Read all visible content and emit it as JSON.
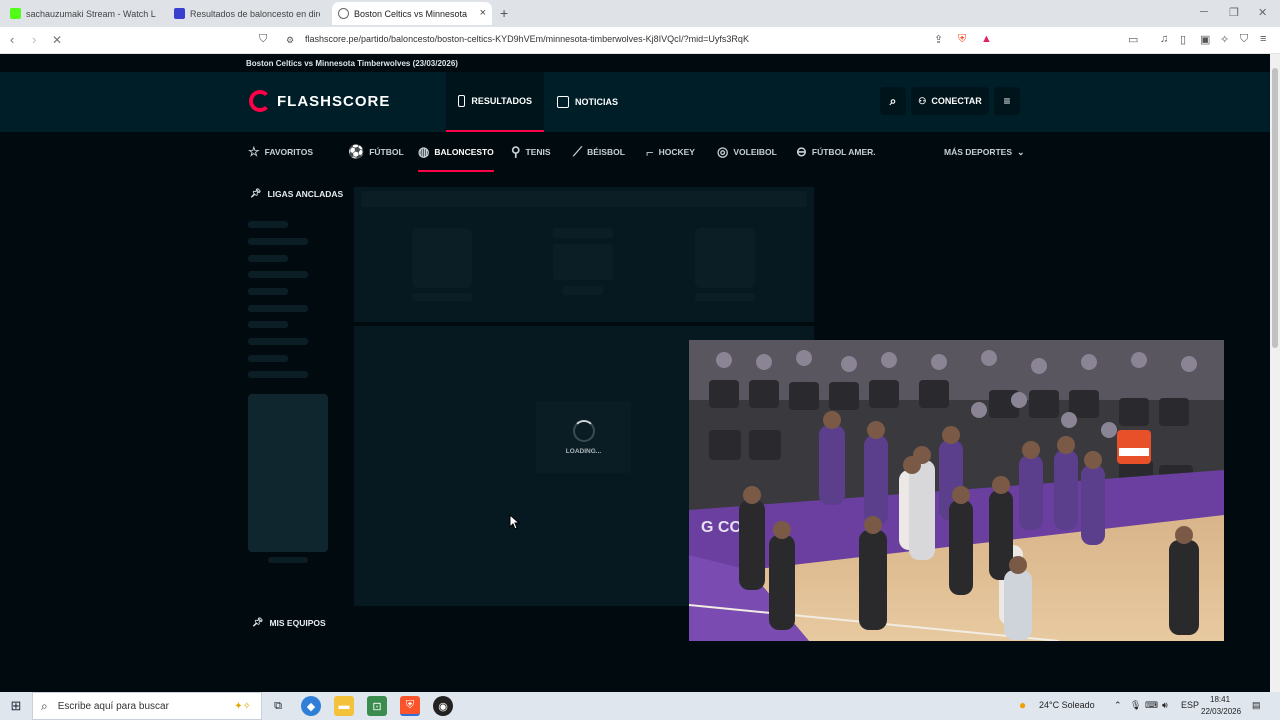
{
  "browser": {
    "tabs": [
      {
        "title": "sachauzumaki Stream - Watch Live o",
        "favicon_color": "#53fc18"
      },
      {
        "title": "Resultados de baloncesto en directo",
        "favicon_color": "#3b3fd0"
      },
      {
        "title": "Boston Celtics vs Minnesota Timb",
        "favicon_color": "#666666"
      }
    ],
    "new_tab_icon": "+",
    "close_icon": "×",
    "url": "flashscore.pe/partido/baloncesto/boston-celtics-KYD9hVEm/minnesota-timberwolves-Kj8IVQcI/?mid=Uyfs3RqK"
  },
  "page": {
    "match_title": "Boston Celtics vs Minnesota Timberwolves (23/03/2026)",
    "logo_text": "FLASHSCORE",
    "header_nav": [
      {
        "label": "RESULTADOS",
        "icon": "scoreboard-icon"
      },
      {
        "label": "NOTICIAS",
        "icon": "news-icon"
      }
    ],
    "login_label": "CONECTAR",
    "sports": [
      {
        "label": "FAVORITOS",
        "icon": "☆"
      },
      {
        "label": "FÚTBOL",
        "icon": "⚽"
      },
      {
        "label": "BALONCESTO",
        "icon": "◍"
      },
      {
        "label": "TENIS",
        "icon": "⚲"
      },
      {
        "label": "BÉISBOL",
        "icon": "⟋"
      },
      {
        "label": "HOCKEY",
        "icon": "⌐"
      },
      {
        "label": "VOLEIBOL",
        "icon": "◎"
      },
      {
        "label": "FÚTBOL AMER.",
        "icon": "⊖"
      }
    ],
    "more_sports_label": "MÁS DEPORTES",
    "pinned_leagues_label": "LIGAS ANCLADAS",
    "my_teams_label": "MIS EQUIPOS",
    "loading_label": "LOADING..."
  },
  "taskbar": {
    "search_placeholder": "Escribe aquí para buscar",
    "weather": "24°C Soleado",
    "language": "ESP",
    "time": "18:41",
    "date": "22/03/2026"
  },
  "colors": {
    "accent": "#ff0046",
    "header_bg": "#001e28",
    "page_bg": "#010a0f"
  }
}
